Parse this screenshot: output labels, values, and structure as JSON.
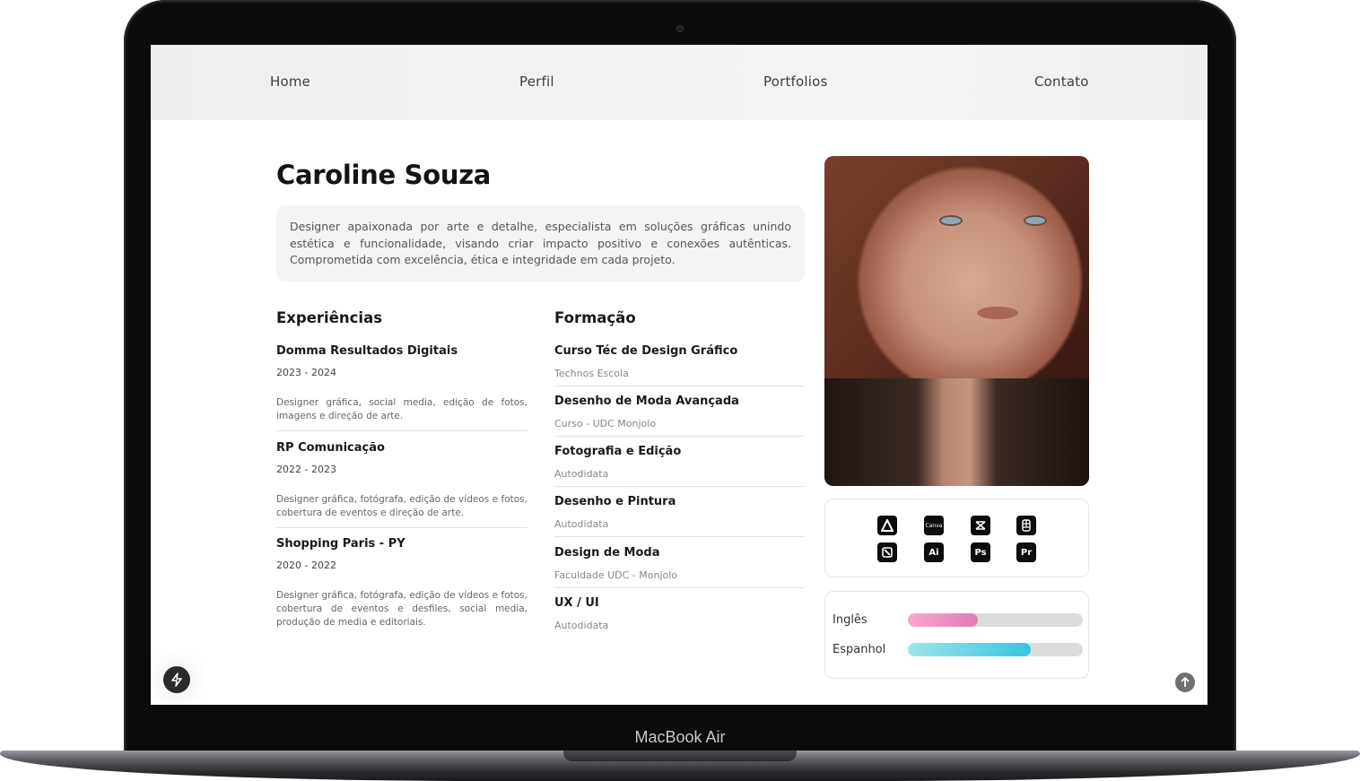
{
  "device": {
    "label": "MacBook Air"
  },
  "nav": {
    "items": [
      "Home",
      "Perfil",
      "Portfolios",
      "Contato"
    ]
  },
  "profile": {
    "name": "Caroline Souza",
    "bio": "Designer apaixonada por arte e detalhe, especialista em soluções gráficas unindo estética e funcionalidade, visando criar impacto positivo e conexões autênticas. Comprometida com excelência, ética e integridade em cada projeto."
  },
  "experience": {
    "title": "Experiências",
    "items": [
      {
        "company": "Domma Resultados Digitais",
        "dates": "2023 - 2024",
        "description": "Designer gráfica, social media, edição de fotos, imagens e direção de arte."
      },
      {
        "company": "RP Comunicação",
        "dates": "2022 - 2023",
        "description": "Designer gráfica, fotógrafa, edição de vídeos e fotos, cobertura de eventos e direção de arte."
      },
      {
        "company": "Shopping Paris - PY",
        "dates": "2020 - 2022",
        "description": "Designer gráfica, fotógrafa, edição de vídeos e fotos, cobertura de eventos e desfiles, social media, produção de media e editoriais."
      }
    ]
  },
  "education": {
    "title": "Formação",
    "items": [
      {
        "course": "Curso Téc de Design Gráfico",
        "school": "Technos Escola"
      },
      {
        "course": "Desenho de Moda Avançada",
        "school": "Curso - UDC Monjolo"
      },
      {
        "course": "Fotografia e Edição",
        "school": "Autodidata"
      },
      {
        "course": "Desenho e Pintura",
        "school": "Autodidata"
      },
      {
        "course": "Design de Moda",
        "school": "Faculdade UDC - Monjolo"
      },
      {
        "course": "UX / UI",
        "school": "Autodidata"
      }
    ]
  },
  "tools": {
    "icons": [
      "affinity-icon",
      "canva-icon",
      "capcut-icon",
      "figma-icon",
      "notion-icon",
      "illustrator-icon",
      "photoshop-icon",
      "premiere-icon"
    ],
    "labels": {
      "canva": "Canva",
      "illustrator": "Ai",
      "photoshop": "Ps",
      "premiere": "Pr"
    }
  },
  "languages": [
    {
      "name": "Inglês",
      "level": 0.4,
      "color_from": "#f7a8cf",
      "color_to": "#e07cb4"
    },
    {
      "name": "Espanhol",
      "level": 0.7,
      "color_from": "#9fe3ee",
      "color_to": "#37c6e0"
    }
  ],
  "floating": {
    "left_icon": "bolt-icon",
    "right_icon": "arrow-up-icon"
  }
}
